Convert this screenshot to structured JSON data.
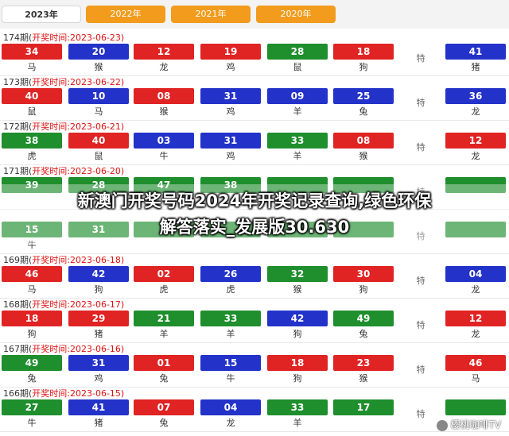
{
  "tabs": [
    {
      "label": "2023年",
      "active": true
    },
    {
      "label": "2022年",
      "active": false
    },
    {
      "label": "2021年",
      "active": false
    },
    {
      "label": "2020年",
      "active": false
    }
  ],
  "special_label": "特",
  "draws": [
    {
      "title_prefix": "174期(",
      "title_mid": "开奖时间:2023-06-23)",
      "balls": [
        {
          "n": "34",
          "z": "马",
          "c": "red"
        },
        {
          "n": "20",
          "z": "猴",
          "c": "blue"
        },
        {
          "n": "12",
          "z": "龙",
          "c": "red"
        },
        {
          "n": "19",
          "z": "鸡",
          "c": "red"
        },
        {
          "n": "28",
          "z": "鼠",
          "c": "green"
        },
        {
          "n": "18",
          "z": "狗",
          "c": "red"
        }
      ],
      "special": {
        "n": "41",
        "z": "猪",
        "c": "blue"
      }
    },
    {
      "title_prefix": "173期(",
      "title_mid": "开奖时间:2023-06-22)",
      "balls": [
        {
          "n": "40",
          "z": "鼠",
          "c": "red"
        },
        {
          "n": "10",
          "z": "马",
          "c": "blue"
        },
        {
          "n": "08",
          "z": "猴",
          "c": "red"
        },
        {
          "n": "31",
          "z": "鸡",
          "c": "blue"
        },
        {
          "n": "09",
          "z": "羊",
          "c": "blue"
        },
        {
          "n": "25",
          "z": "兔",
          "c": "blue"
        }
      ],
      "special": {
        "n": "36",
        "z": "龙",
        "c": "blue"
      }
    },
    {
      "title_prefix": "172期(",
      "title_mid": "开奖时间:2023-06-21)",
      "balls": [
        {
          "n": "38",
          "z": "虎",
          "c": "green"
        },
        {
          "n": "40",
          "z": "鼠",
          "c": "red"
        },
        {
          "n": "03",
          "z": "牛",
          "c": "blue"
        },
        {
          "n": "31",
          "z": "鸡",
          "c": "blue"
        },
        {
          "n": "33",
          "z": "羊",
          "c": "green"
        },
        {
          "n": "08",
          "z": "猴",
          "c": "red"
        }
      ],
      "special": {
        "n": "12",
        "z": "龙",
        "c": "red"
      }
    },
    {
      "title_prefix": "171期(",
      "title_mid": "开奖时间:2023-06-20)",
      "balls": [
        {
          "n": "39",
          "z": "",
          "c": "green"
        },
        {
          "n": "28",
          "z": "",
          "c": "green"
        },
        {
          "n": "47",
          "z": "",
          "c": "green"
        },
        {
          "n": "38",
          "z": "",
          "c": "green"
        },
        {
          "n": "",
          "z": "",
          "c": "green"
        },
        {
          "n": "",
          "z": "",
          "c": "green"
        }
      ],
      "special": {
        "n": "",
        "z": "",
        "c": "green"
      }
    },
    {
      "title_prefix": "",
      "title_mid": "",
      "balls": [
        {
          "n": "15",
          "z": "牛",
          "c": "green"
        },
        {
          "n": "31",
          "z": "",
          "c": "green"
        },
        {
          "n": "",
          "z": "",
          "c": "green"
        },
        {
          "n": "",
          "z": "",
          "c": "green"
        },
        {
          "n": "",
          "z": "",
          "c": "green"
        },
        {
          "n": "",
          "z": "",
          "c": "green"
        }
      ],
      "special": {
        "n": "",
        "z": "",
        "c": "green"
      }
    },
    {
      "title_prefix": "169期(",
      "title_mid": "开奖时间:2023-06-18)",
      "balls": [
        {
          "n": "46",
          "z": "马",
          "c": "red"
        },
        {
          "n": "42",
          "z": "狗",
          "c": "blue"
        },
        {
          "n": "02",
          "z": "虎",
          "c": "red"
        },
        {
          "n": "26",
          "z": "虎",
          "c": "blue"
        },
        {
          "n": "32",
          "z": "猴",
          "c": "green"
        },
        {
          "n": "30",
          "z": "狗",
          "c": "red"
        }
      ],
      "special": {
        "n": "04",
        "z": "龙",
        "c": "blue"
      }
    },
    {
      "title_prefix": "168期(",
      "title_mid": "开奖时间:2023-06-17)",
      "balls": [
        {
          "n": "18",
          "z": "狗",
          "c": "red"
        },
        {
          "n": "29",
          "z": "猪",
          "c": "red"
        },
        {
          "n": "21",
          "z": "羊",
          "c": "green"
        },
        {
          "n": "33",
          "z": "羊",
          "c": "green"
        },
        {
          "n": "42",
          "z": "狗",
          "c": "blue"
        },
        {
          "n": "49",
          "z": "兔",
          "c": "green"
        }
      ],
      "special": {
        "n": "12",
        "z": "龙",
        "c": "red"
      }
    },
    {
      "title_prefix": "167期(",
      "title_mid": "开奖时间:2023-06-16)",
      "balls": [
        {
          "n": "49",
          "z": "兔",
          "c": "green"
        },
        {
          "n": "31",
          "z": "鸡",
          "c": "blue"
        },
        {
          "n": "01",
          "z": "兔",
          "c": "red"
        },
        {
          "n": "15",
          "z": "牛",
          "c": "blue"
        },
        {
          "n": "18",
          "z": "狗",
          "c": "red"
        },
        {
          "n": "23",
          "z": "猴",
          "c": "red"
        }
      ],
      "special": {
        "n": "46",
        "z": "马",
        "c": "red"
      }
    },
    {
      "title_prefix": "166期(",
      "title_mid": "开奖时间:2023-06-15)",
      "balls": [
        {
          "n": "27",
          "z": "牛",
          "c": "green"
        },
        {
          "n": "41",
          "z": "猪",
          "c": "blue"
        },
        {
          "n": "07",
          "z": "兔",
          "c": "red"
        },
        {
          "n": "04",
          "z": "龙",
          "c": "blue"
        },
        {
          "n": "33",
          "z": "羊",
          "c": "green"
        },
        {
          "n": "17",
          "z": "",
          "c": "green"
        }
      ],
      "special": {
        "n": "",
        "z": "",
        "c": "green"
      }
    }
  ],
  "overlay_text_line1": "新澳门开奖号码2024年开奖记录查询,绿色环保",
  "overlay_text_line2": "解答落实_发展版30.630",
  "watermark": "樱桃咖啡TV",
  "colors": {
    "red": "#e02323",
    "blue": "#2332c9",
    "green": "#1f8e2d",
    "tab_orange": "#f29b1c"
  }
}
